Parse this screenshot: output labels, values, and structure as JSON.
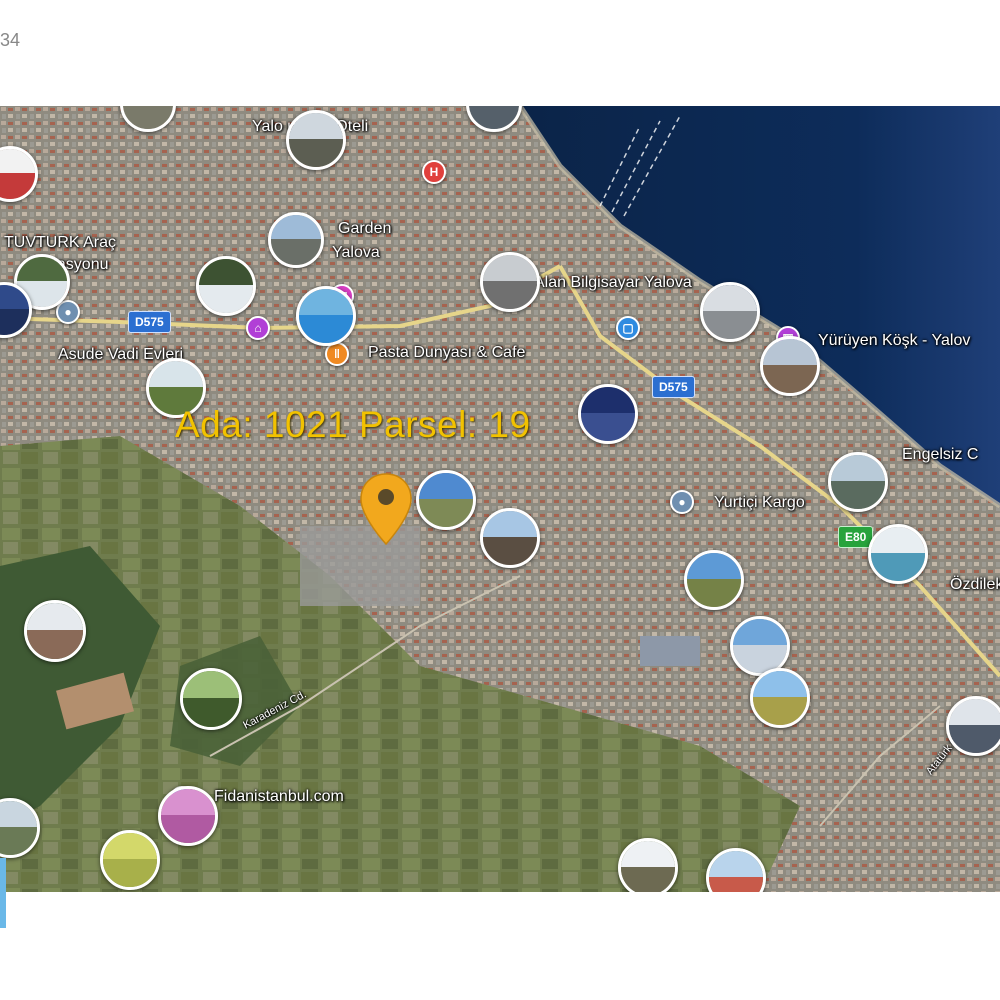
{
  "page": {
    "corner_number": "34"
  },
  "map": {
    "parcel_label": "Ada: 1021  Parsel: 19",
    "road_shields": [
      {
        "id": "d575-west",
        "text": "D575"
      },
      {
        "id": "d575-east",
        "text": "D575"
      },
      {
        "id": "e-green",
        "text": "E80"
      }
    ],
    "place_labels": [
      {
        "id": "otel",
        "text": "Yalo      ulama Oteli"
      },
      {
        "id": "garden",
        "text": "Garden"
      },
      {
        "id": "garden-yalova",
        "text": "Yalova"
      },
      {
        "id": "tuvturk",
        "text": "TUVTURK Araç"
      },
      {
        "id": "istasyonu",
        "text": "Istasyonu"
      },
      {
        "id": "bilgisayar",
        "text": "Alan Bilgisayar Yalova"
      },
      {
        "id": "asude",
        "text": "Asude Vadi Evleri"
      },
      {
        "id": "pasta",
        "text": "Pasta Dunyası & Cafe"
      },
      {
        "id": "kosk",
        "text": "Yürüyen Köşk - Yalov"
      },
      {
        "id": "engelsiz",
        "text": "Engelsiz C"
      },
      {
        "id": "yurtici",
        "text": "Yurtiçi Kargo"
      },
      {
        "id": "ozdilek",
        "text": "Özdilek"
      },
      {
        "id": "fidan",
        "text": "Fidanistanbul.com"
      },
      {
        "id": "street1",
        "text": "Karadeniz Cd."
      },
      {
        "id": "street2",
        "text": "Atatürk Cd."
      }
    ]
  }
}
